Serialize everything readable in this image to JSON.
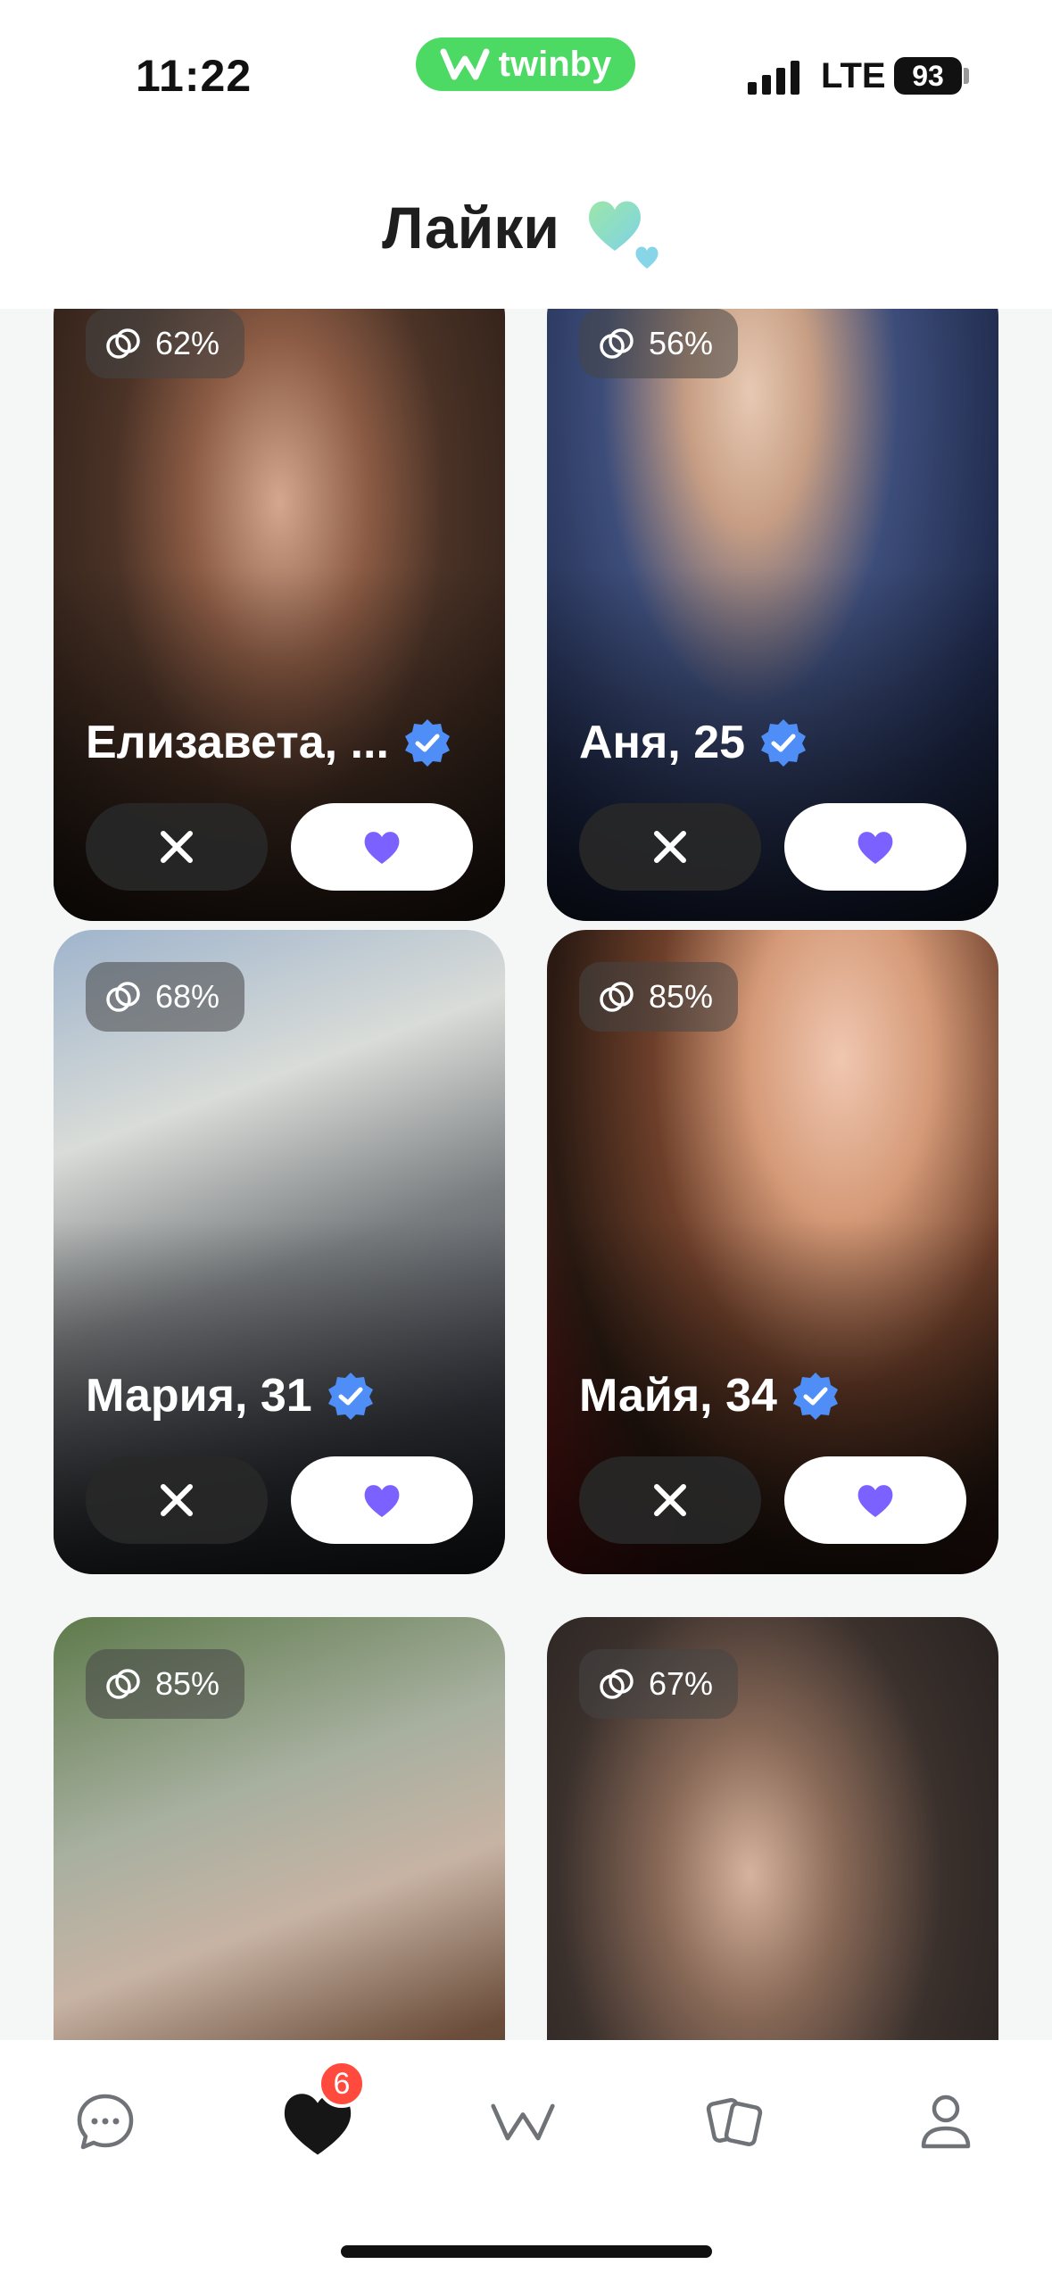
{
  "status_bar": {
    "time": "11:22",
    "network": "LTE",
    "battery": "93"
  },
  "app_pill": {
    "label": "twinby",
    "color": "#4cd964"
  },
  "header": {
    "title": "Лайки",
    "icon": "hearts-icon"
  },
  "cards": [
    {
      "match": "62%",
      "name": "Елизавета, ...",
      "verified": true
    },
    {
      "match": "56%",
      "name": "Аня, 25",
      "verified": true
    },
    {
      "match": "68%",
      "name": "Мария, 31",
      "verified": true
    },
    {
      "match": "85%",
      "name": "Майя, 34",
      "verified": true
    },
    {
      "match": "85%",
      "name": "",
      "verified": false
    },
    {
      "match": "67%",
      "name": "",
      "verified": false
    }
  ],
  "bottom_nav": {
    "items": [
      "chat-icon",
      "likes-heart-icon",
      "twinby-logo-icon",
      "cards-icon",
      "profile-icon"
    ],
    "likes_badge": "6",
    "accent": "#7b61ff"
  }
}
